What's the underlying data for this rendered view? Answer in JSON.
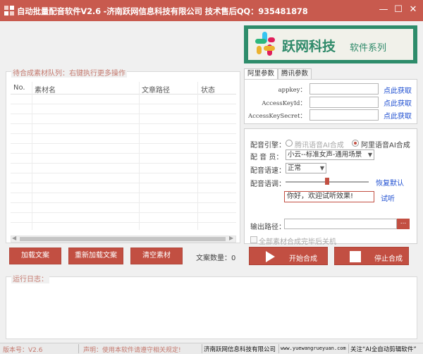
{
  "window": {
    "title": "自动批量配音软件V2.6 -济南跃网信息科技有限公司 技术售后QQ：935481878",
    "controls": {
      "minimize": "—",
      "maximize": "☐",
      "close": "✕"
    },
    "icon": "app-grid-icon"
  },
  "banner": {
    "brand": "跃网科技",
    "series": "软件系列"
  },
  "queue": {
    "legend": "待合成素材队列：右键执行更多操作",
    "columns": [
      "No.",
      "素材名",
      "文章路径",
      "状态"
    ],
    "rows": []
  },
  "buttons": {
    "load": "加载文案",
    "reload": "重新加载文案",
    "clear": "清空素材",
    "count_label": "文案数量：0",
    "start": "开始合成",
    "stop": "停止合成"
  },
  "tabs": [
    {
      "label": "阿里参数",
      "active": true
    },
    {
      "label": "腾讯参数",
      "active": false
    }
  ],
  "ali": {
    "appkey_label": "appkey：",
    "access_key_id_label": "AccessKeyId：",
    "access_key_secret_label": "AccessKeySecret：",
    "appkey_value": "",
    "access_key_id_value": "",
    "access_key_secret_value": "",
    "get_link": "点此获取"
  },
  "settings": {
    "engine_label": "配音引擎：",
    "engine_options": [
      "腾讯语音AI合成",
      "阿里语音AI合成"
    ],
    "engine_selected": "阿里语音AI合成",
    "voice_label": "配 音 员：",
    "voice_value": "小云--标准女声-通用场景",
    "speed_label": "配音语速：",
    "speed_value": "正常",
    "tone_label": "配音语调：",
    "tone_level": 0.5,
    "reset_link": "恢复默认",
    "preview_text": "你好，欢迎试听效果!",
    "listen_link": "试听",
    "output_label": "输出路径：",
    "output_value": "",
    "browse_label": "...",
    "shutdown_label": "全部素材合成完毕后关机"
  },
  "log": {
    "legend": "运行日志："
  },
  "status": {
    "version": "版本号：V2.6",
    "notice": "声明：使用本软件请遵守相关规定!",
    "company": "济南跃网信息科技有限公司",
    "website": "www.yuewangrueyuan.com",
    "follow": "关注“AI全自动剪辑软件”"
  },
  "colors": {
    "titlebar": "#c85a4e",
    "accent": "#c24f42",
    "link": "#1f4fd1",
    "banner_green": "#2e8c6b"
  }
}
